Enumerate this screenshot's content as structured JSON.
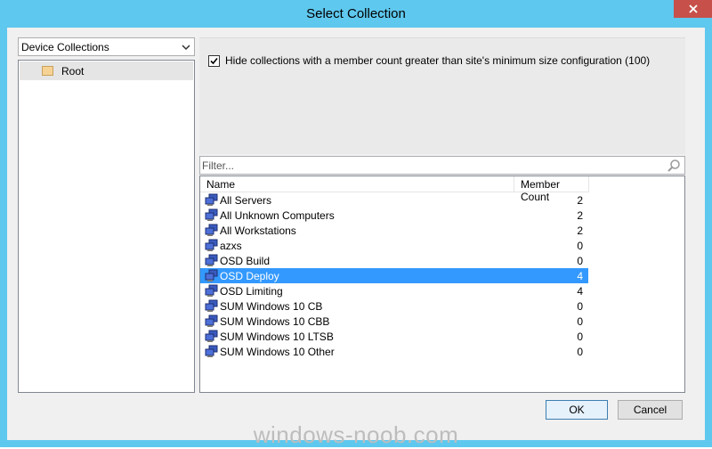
{
  "window": {
    "title": "Select Collection"
  },
  "dropdown": {
    "selected": "Device Collections"
  },
  "tree": {
    "items": [
      {
        "label": "Root"
      }
    ]
  },
  "option": {
    "checked": true,
    "label": "Hide collections with a member count greater than site's minimum size configuration (100)"
  },
  "filter": {
    "placeholder": "Filter..."
  },
  "list": {
    "columns": [
      "Name",
      "Member Count"
    ],
    "rows": [
      {
        "name": "All Servers",
        "count": "2"
      },
      {
        "name": "All Unknown Computers",
        "count": "2"
      },
      {
        "name": "All Workstations",
        "count": "2"
      },
      {
        "name": "azxs",
        "count": "0"
      },
      {
        "name": "OSD Build",
        "count": "0"
      },
      {
        "name": "OSD Deploy",
        "count": "4",
        "selected": true
      },
      {
        "name": "OSD Limiting",
        "count": "4"
      },
      {
        "name": "SUM Windows 10 CB",
        "count": "0"
      },
      {
        "name": "SUM Windows 10 CBB",
        "count": "0"
      },
      {
        "name": "SUM Windows 10 LTSB",
        "count": "0"
      },
      {
        "name": "SUM Windows 10 Other",
        "count": "0"
      }
    ]
  },
  "buttons": {
    "ok": "OK",
    "cancel": "Cancel"
  },
  "watermark": "windows-noob.com",
  "colors": {
    "titlebar": "#5fc8ee",
    "selection": "#3399ff",
    "close": "#c7504a"
  }
}
